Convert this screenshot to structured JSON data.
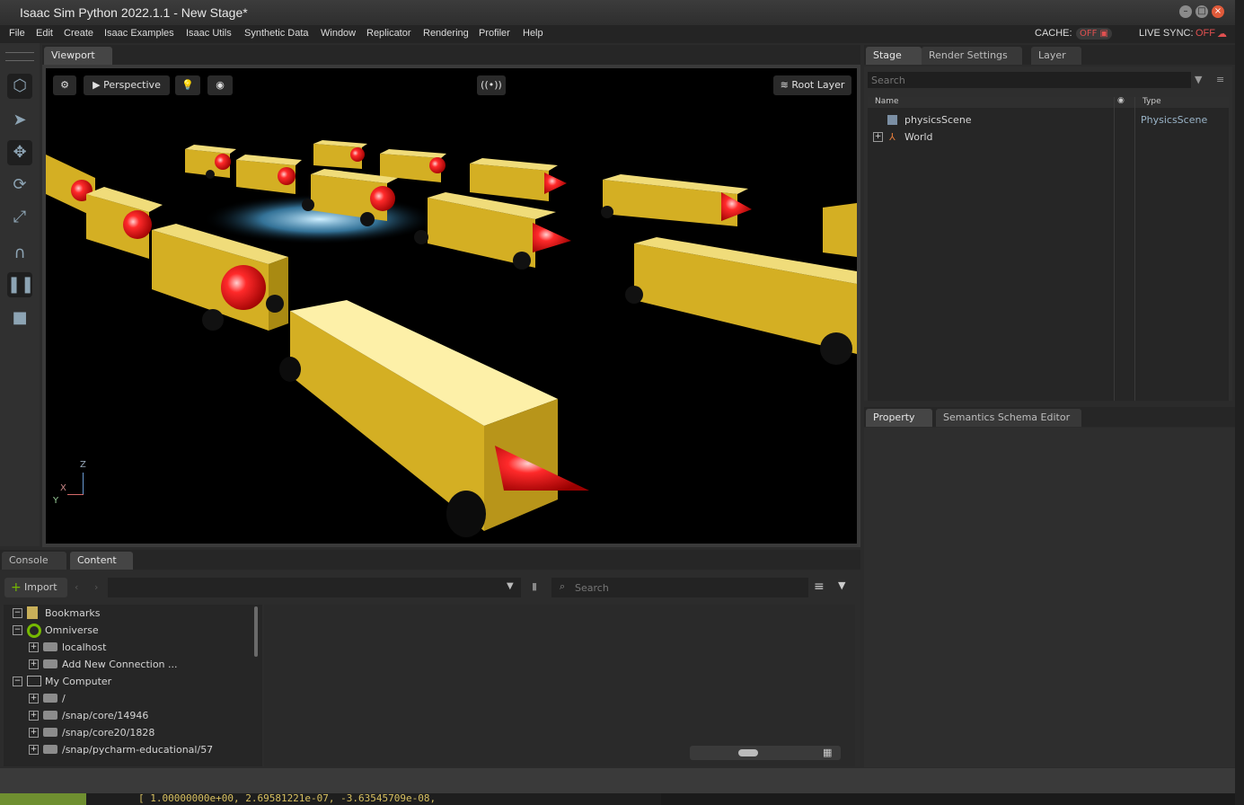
{
  "window": {
    "title": "Isaac Sim Python 2022.1.1 - New Stage*"
  },
  "menu": [
    "File",
    "Edit",
    "Create",
    "Isaac Examples",
    "Isaac Utils",
    "Synthetic Data",
    "Window",
    "Replicator",
    "Rendering",
    "Profiler",
    "Help"
  ],
  "status": {
    "cache_label": "CACHE:",
    "cache_value": "OFF",
    "live_label": "LIVE SYNC:",
    "live_value": "OFF"
  },
  "viewport": {
    "tab": "Viewport",
    "camera": "Perspective",
    "layer": "Root Layer",
    "axes": {
      "z": "Z",
      "x": "X",
      "y": "Y"
    }
  },
  "stage": {
    "tabs": [
      "Stage",
      "Render Settings",
      "Layer"
    ],
    "search_placeholder": "Search",
    "col_name": "Name",
    "col_type": "Type",
    "rows": [
      {
        "name": "physicsScene",
        "type": "PhysicsScene"
      },
      {
        "name": "World",
        "type": ""
      }
    ]
  },
  "property": {
    "tabs": [
      "Property",
      "Semantics Schema Editor"
    ]
  },
  "content": {
    "tabs": [
      "Console",
      "Content"
    ],
    "import_label": "Import",
    "search_placeholder": "Search",
    "tree": [
      {
        "label": "Bookmarks",
        "level": 0,
        "exp": "−"
      },
      {
        "label": "Omniverse",
        "level": 0,
        "exp": "−"
      },
      {
        "label": "localhost",
        "level": 1,
        "exp": "+"
      },
      {
        "label": "Add New Connection ...",
        "level": 1,
        "exp": "+"
      },
      {
        "label": "My Computer",
        "level": 0,
        "exp": "−"
      },
      {
        "label": "/",
        "level": 1,
        "exp": "+"
      },
      {
        "label": "/snap/core/14946",
        "level": 1,
        "exp": "+"
      },
      {
        "label": "/snap/core20/1828",
        "level": 1,
        "exp": "+"
      },
      {
        "label": "/snap/pycharm-educational/57",
        "level": 1,
        "exp": "+"
      }
    ]
  },
  "background_terminal": {
    "text": "[ 1.00000000e+00,  2.69581221e-07, -3.63545709e-08,"
  },
  "colors": {
    "accent": "#76b900",
    "off": "#e05050"
  }
}
